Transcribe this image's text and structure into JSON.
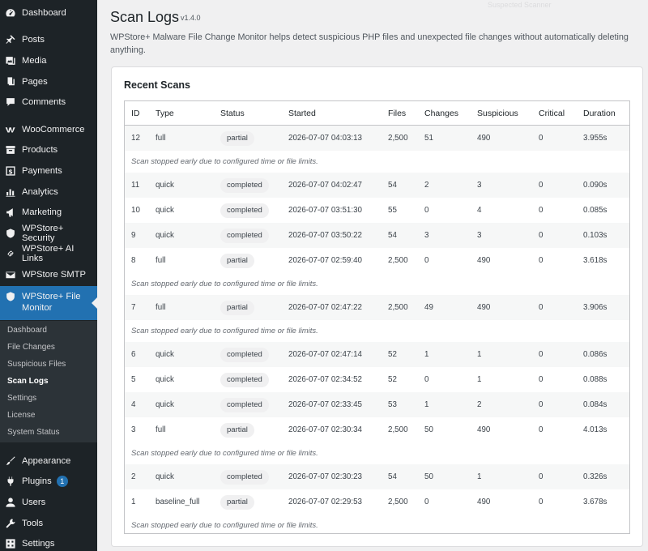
{
  "sidebar": {
    "items": [
      {
        "id": "dashboard",
        "label": "Dashboard",
        "icon": "gauge-icon"
      },
      {
        "id": "posts",
        "label": "Posts",
        "icon": "pin-icon"
      },
      {
        "id": "media",
        "label": "Media",
        "icon": "media-icon"
      },
      {
        "id": "pages",
        "label": "Pages",
        "icon": "pages-icon"
      },
      {
        "id": "comments",
        "label": "Comments",
        "icon": "comment-icon"
      },
      {
        "id": "woocommerce",
        "label": "WooCommerce",
        "icon": "woo-icon"
      },
      {
        "id": "products",
        "label": "Products",
        "icon": "archive-icon"
      },
      {
        "id": "payments",
        "label": "Payments",
        "icon": "dollar-icon"
      },
      {
        "id": "analytics",
        "label": "Analytics",
        "icon": "bar-chart-icon"
      },
      {
        "id": "marketing",
        "label": "Marketing",
        "icon": "megaphone-icon"
      },
      {
        "id": "security",
        "label": "WPStore+ Security",
        "icon": "shield-icon"
      },
      {
        "id": "ailinks",
        "label": "WPStore+ AI Links",
        "icon": "link-icon"
      },
      {
        "id": "smtp",
        "label": "WPStore SMTP",
        "icon": "envelope-icon"
      },
      {
        "id": "filemonitor",
        "label": "WPStore+ File Monitor",
        "icon": "shield-icon",
        "active": true
      },
      {
        "id": "appearance",
        "label": "Appearance",
        "icon": "brush-icon"
      },
      {
        "id": "plugins",
        "label": "Plugins",
        "icon": "plug-icon",
        "badge": "1"
      },
      {
        "id": "users",
        "label": "Users",
        "icon": "user-icon"
      },
      {
        "id": "tools",
        "label": "Tools",
        "icon": "wrench-icon"
      },
      {
        "id": "settings",
        "label": "Settings",
        "icon": "settings-icon"
      }
    ],
    "submenu": [
      {
        "label": "Dashboard"
      },
      {
        "label": "File Changes"
      },
      {
        "label": "Suspicious Files"
      },
      {
        "label": "Scan Logs",
        "current": true
      },
      {
        "label": "Settings"
      },
      {
        "label": "License"
      },
      {
        "label": "System Status"
      }
    ]
  },
  "header": {
    "title": "Scan Logs",
    "version": "v1.4.0",
    "top_faded": "Suspected Scanner",
    "description": "WPStore+ Malware File Change Monitor helps detect suspicious PHP files and unexpected file changes without automatically deleting anything."
  },
  "card": {
    "title": "Recent Scans",
    "columns": [
      "ID",
      "Type",
      "Status",
      "Started",
      "Files",
      "Changes",
      "Suspicious",
      "Critical",
      "Duration"
    ],
    "rows": [
      {
        "id": "12",
        "type": "full",
        "status": "partial",
        "started": "2026-07-07 04:03:13",
        "files": "2,500",
        "changes": "51",
        "suspicious": "490",
        "critical": "0",
        "duration": "3.955s",
        "note": "Scan stopped early due to configured time or file limits."
      },
      {
        "id": "11",
        "type": "quick",
        "status": "completed",
        "started": "2026-07-07 04:02:47",
        "files": "54",
        "changes": "2",
        "suspicious": "3",
        "critical": "0",
        "duration": "0.090s"
      },
      {
        "id": "10",
        "type": "quick",
        "status": "completed",
        "started": "2026-07-07 03:51:30",
        "files": "55",
        "changes": "0",
        "suspicious": "4",
        "critical": "0",
        "duration": "0.085s"
      },
      {
        "id": "9",
        "type": "quick",
        "status": "completed",
        "started": "2026-07-07 03:50:22",
        "files": "54",
        "changes": "3",
        "suspicious": "3",
        "critical": "0",
        "duration": "0.103s"
      },
      {
        "id": "8",
        "type": "full",
        "status": "partial",
        "started": "2026-07-07 02:59:40",
        "files": "2,500",
        "changes": "0",
        "suspicious": "490",
        "critical": "0",
        "duration": "3.618s",
        "note": "Scan stopped early due to configured time or file limits."
      },
      {
        "id": "7",
        "type": "full",
        "status": "partial",
        "started": "2026-07-07 02:47:22",
        "files": "2,500",
        "changes": "49",
        "suspicious": "490",
        "critical": "0",
        "duration": "3.906s",
        "note": "Scan stopped early due to configured time or file limits."
      },
      {
        "id": "6",
        "type": "quick",
        "status": "completed",
        "started": "2026-07-07 02:47:14",
        "files": "52",
        "changes": "1",
        "suspicious": "1",
        "critical": "0",
        "duration": "0.086s"
      },
      {
        "id": "5",
        "type": "quick",
        "status": "completed",
        "started": "2026-07-07 02:34:52",
        "files": "52",
        "changes": "0",
        "suspicious": "1",
        "critical": "0",
        "duration": "0.088s"
      },
      {
        "id": "4",
        "type": "quick",
        "status": "completed",
        "started": "2026-07-07 02:33:45",
        "files": "53",
        "changes": "1",
        "suspicious": "2",
        "critical": "0",
        "duration": "0.084s"
      },
      {
        "id": "3",
        "type": "full",
        "status": "partial",
        "started": "2026-07-07 02:30:34",
        "files": "2,500",
        "changes": "50",
        "suspicious": "490",
        "critical": "0",
        "duration": "4.013s",
        "note": "Scan stopped early due to configured time or file limits."
      },
      {
        "id": "2",
        "type": "quick",
        "status": "completed",
        "started": "2026-07-07 02:30:23",
        "files": "54",
        "changes": "50",
        "suspicious": "1",
        "critical": "0",
        "duration": "0.326s"
      },
      {
        "id": "1",
        "type": "baseline_full",
        "status": "partial",
        "started": "2026-07-07 02:29:53",
        "files": "2,500",
        "changes": "0",
        "suspicious": "490",
        "critical": "0",
        "duration": "3.678s",
        "note": "Scan stopped early due to configured time or file limits."
      }
    ]
  },
  "colors": {
    "sidebar_bg": "#1d2327",
    "submenu_bg": "#2c3338",
    "accent": "#2271b1",
    "page_bg": "#f0f0f1"
  }
}
